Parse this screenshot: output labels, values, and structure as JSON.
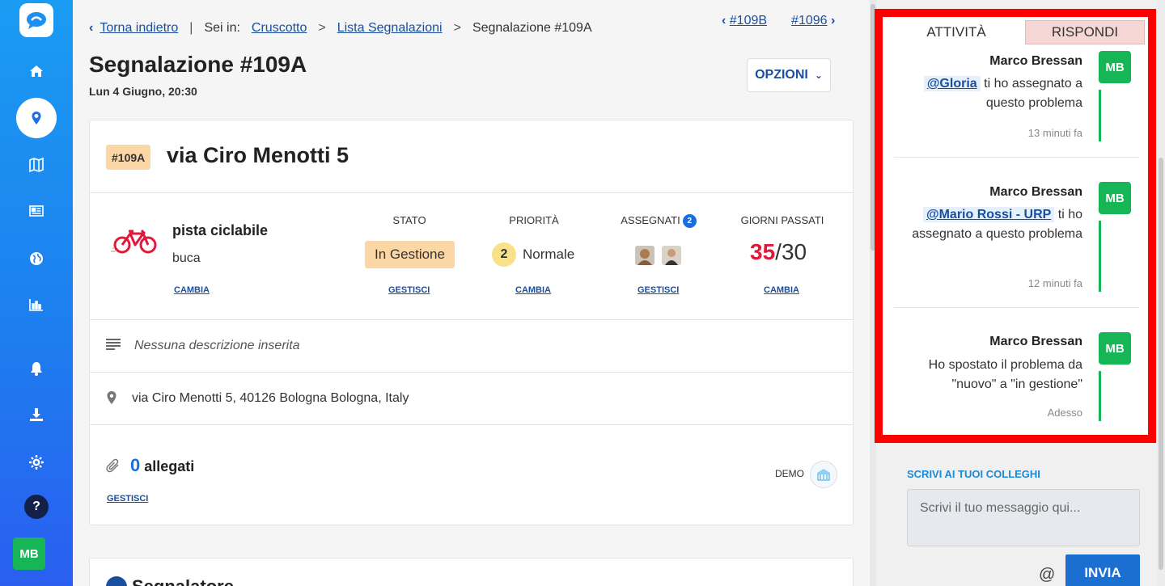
{
  "breadcrumb": {
    "back": "Torna indietro",
    "you_are_in": "Sei in:",
    "items": [
      "Cruscotto",
      "Lista Segnalazioni"
    ],
    "current": "Segnalazione #109A"
  },
  "nav": {
    "prev": "#109B",
    "next": "#1096"
  },
  "header": {
    "title": "Segnalazione #109A",
    "date": "Lun 4 Giugno, 20:30",
    "options_label": "OPZIONI"
  },
  "report": {
    "tag": "#109A",
    "title": "via Ciro Menotti 5",
    "category": "pista ciclabile",
    "subcategory": "buca",
    "category_action": "CAMBIA",
    "state": {
      "label": "STATO",
      "value": "In Gestione",
      "action": "GESTISCI"
    },
    "priority": {
      "label": "PRIORITÀ",
      "level": "2",
      "value": "Normale",
      "action": "CAMBIA"
    },
    "assigned": {
      "label": "ASSEGNATI",
      "count": "2",
      "action": "GESTISCI"
    },
    "days": {
      "label": "GIORNI PASSATI",
      "elapsed": "35",
      "separator": "/",
      "limit": "30",
      "action": "CAMBIA"
    },
    "description": "Nessuna descrizione inserita",
    "address": "via Ciro Menotti 5, 40126 Bologna Bologna, Italy",
    "attachments": {
      "count": "0",
      "label": "allegati",
      "action": "GESTISCI"
    },
    "source": "DEMO"
  },
  "section2": {
    "title": "Segnalatore"
  },
  "activity": {
    "tab_activity": "ATTIVITÀ",
    "tab_reply": "RISPONDI",
    "entries": [
      {
        "author": "Marco Bressan",
        "mention": "@Gloria",
        "text": "ti ho assegnato a questo problema",
        "time": "13 minuti fa",
        "initials": "MB"
      },
      {
        "author": "Marco Bressan",
        "mention": "@Mario Rossi - URP",
        "text": "ti ho assegnato a questo problema",
        "time": "12 minuti fa",
        "initials": "MB"
      },
      {
        "author": "Marco Bressan",
        "mention": "",
        "text": "Ho spostato il problema da \"nuovo\" a \"in gestione\"",
        "time": "Adesso",
        "initials": "MB"
      }
    ]
  },
  "compose": {
    "label": "SCRIVI AI TUOI COLLEGHI",
    "placeholder": "Scrivi il tuo messaggio qui...",
    "at": "@",
    "send": "INVIA"
  },
  "user": {
    "initials": "MB"
  },
  "sidebar": {
    "icons": [
      "home-icon",
      "map-pin-icon",
      "map-icon",
      "newspaper-icon",
      "globe-icon",
      "chart-icon",
      "bell-icon",
      "download-icon",
      "gear-icon"
    ],
    "help": "?"
  },
  "colors": {
    "brand": "#1d7fef",
    "accent": "#1a4fa0",
    "success": "#16b657",
    "warning": "#fbd7a6",
    "danger": "#e2173a"
  }
}
